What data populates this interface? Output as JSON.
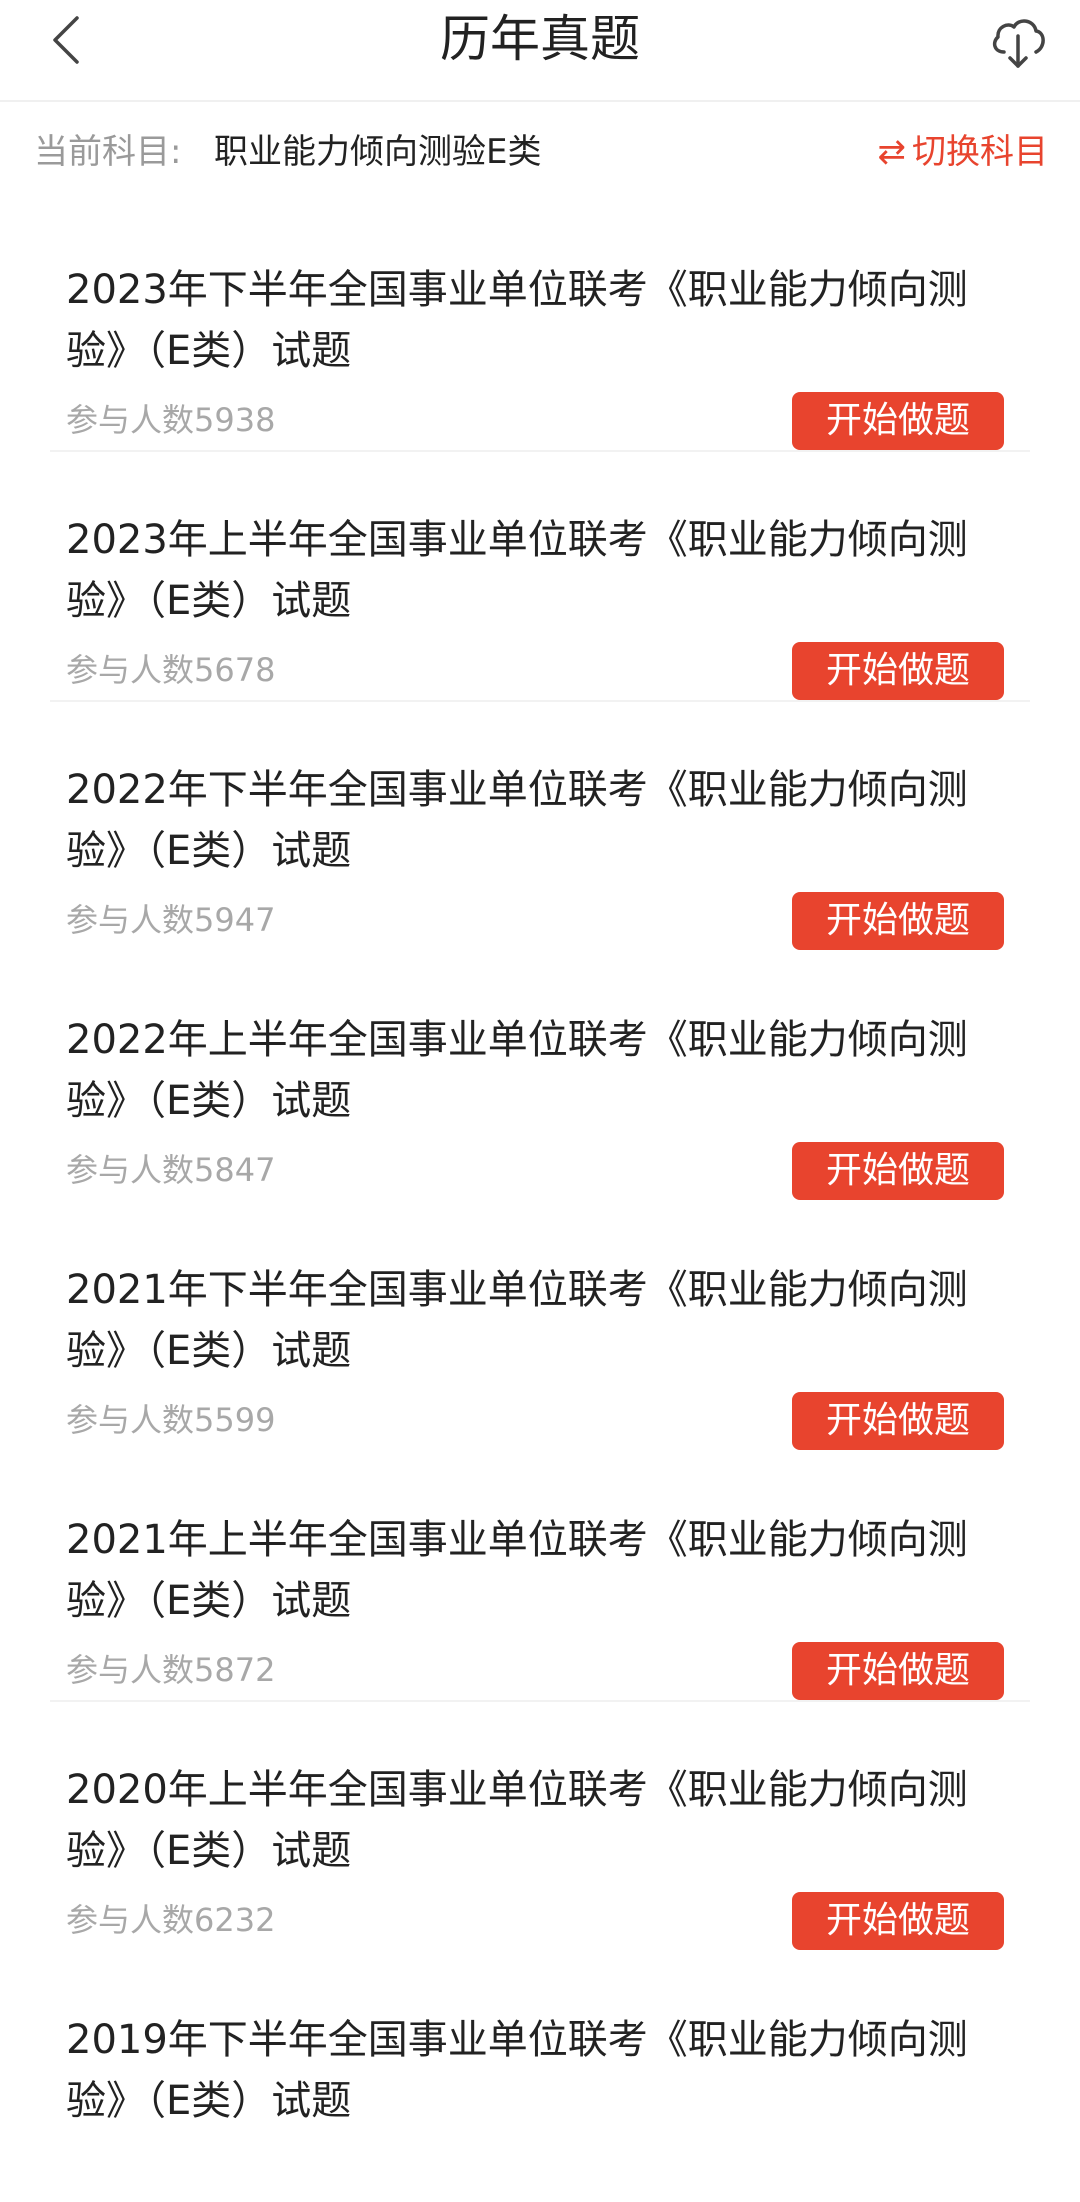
{
  "header": {
    "title": "历年真题",
    "back_icon": "chevron-left-icon",
    "download_icon": "cloud-download-icon"
  },
  "subject": {
    "label": "当前科目:",
    "value": "职业能力倾向测验E类",
    "switch_icon": "⇄",
    "switch_label": "切换科目"
  },
  "colors": {
    "accent": "#e8442e",
    "muted": "#a8a8a8"
  },
  "items": [
    {
      "title": "2023年下半年全国事业单位联考《职业能力倾向测验》（E类）试题",
      "participants": "参与人数5938",
      "button": "开始做题"
    },
    {
      "title": "2023年上半年全国事业单位联考《职业能力倾向测验》（E类）试题",
      "participants": "参与人数5678",
      "button": "开始做题"
    },
    {
      "title": "2022年下半年全国事业单位联考《职业能力倾向测验》（E类）试题",
      "participants": "参与人数5947",
      "button": "开始做题"
    },
    {
      "title": "2022年上半年全国事业单位联考《职业能力倾向测验》（E类）试题",
      "participants": "参与人数5847",
      "button": "开始做题"
    },
    {
      "title": "2021年下半年全国事业单位联考《职业能力倾向测验》（E类）试题",
      "participants": "参与人数5599",
      "button": "开始做题"
    },
    {
      "title": "2021年上半年全国事业单位联考《职业能力倾向测验》（E类）试题",
      "participants": "参与人数5872",
      "button": "开始做题"
    },
    {
      "title": "2020年上半年全国事业单位联考《职业能力倾向测验》（E类）试题",
      "participants": "参与人数6232",
      "button": "开始做题"
    },
    {
      "title": "2019年下半年全国事业单位联考《职业能力倾向测验》（E类）试题",
      "participants": "",
      "button": ""
    }
  ]
}
